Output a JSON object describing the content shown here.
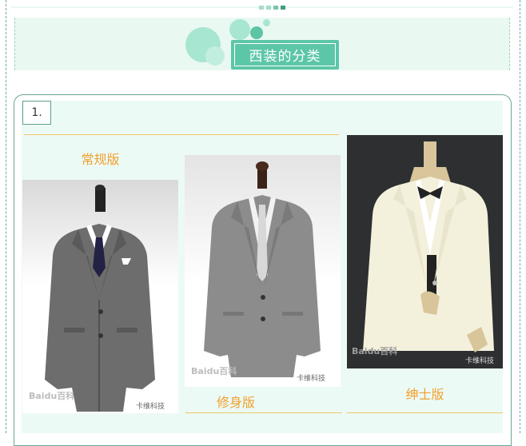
{
  "header": {
    "title": "西装的分类"
  },
  "section": {
    "number": "1.",
    "items": [
      {
        "label": "常规版",
        "watermark_baidu": "Baidu百科",
        "watermark_wx": "卡维科技"
      },
      {
        "label": "修身版",
        "watermark_baidu": "Baidu百科",
        "watermark_wx": "卡维科技"
      },
      {
        "label": "绅士版",
        "watermark_baidu": "Baidu百科",
        "watermark_wx": "卡维科技"
      }
    ]
  },
  "colors": {
    "accent": "#5cc6a8",
    "mint_bg": "#e9f9f2",
    "label": "#f0a030",
    "rule": "#f0c46a",
    "border": "#6aa89a"
  },
  "icons": [
    "decorative-bubbles",
    "suit-photo-regular",
    "suit-photo-slim",
    "suit-photo-tuxedo"
  ]
}
